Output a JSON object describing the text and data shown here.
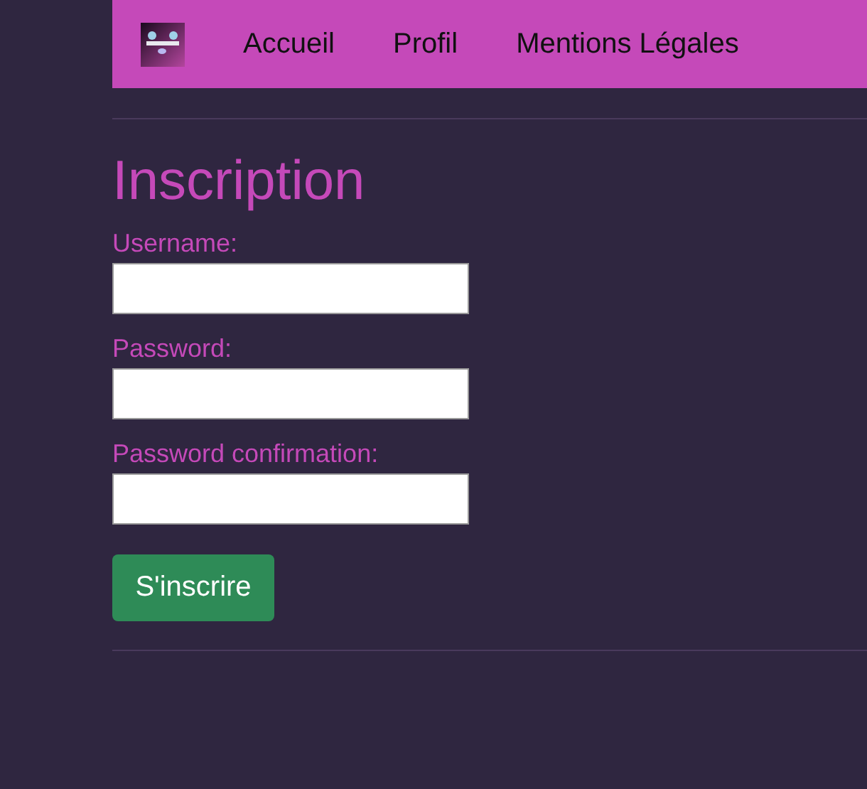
{
  "nav": {
    "items": [
      {
        "label": "Accueil"
      },
      {
        "label": "Profil"
      },
      {
        "label": "Mentions Légales"
      }
    ]
  },
  "form": {
    "title": "Inscription",
    "fields": [
      {
        "label": "Username:"
      },
      {
        "label": "Password:"
      },
      {
        "label": "Password confirmation:"
      }
    ],
    "submit": "S'inscrire"
  }
}
